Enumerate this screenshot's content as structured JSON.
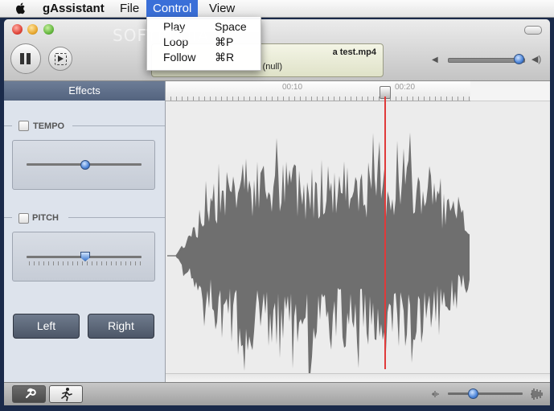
{
  "menubar": {
    "apple_icon": "apple-icon",
    "app_name": "gAssistant",
    "items": [
      "File",
      "Control",
      "View"
    ],
    "active_item": "Control"
  },
  "control_menu": {
    "items": [
      {
        "label": "Play",
        "shortcut": "Space"
      },
      {
        "label": "Loop",
        "shortcut": "⌘P"
      },
      {
        "label": "Follow",
        "shortcut": "⌘R"
      }
    ]
  },
  "watermark": "SOFTPEDIA",
  "toolbar": {
    "pause_icon": "pause-icon",
    "step_icon": "step-play-icon",
    "file_name": "a test.mp4",
    "file_info": "(null)",
    "volume_level": 0.95
  },
  "ruler": {
    "labels": [
      "00:10",
      "00:20"
    ]
  },
  "effects": {
    "header": "Effects",
    "tempo": {
      "label": "TEMPO",
      "checked": false,
      "value": 0.5
    },
    "pitch": {
      "label": "PITCH",
      "checked": false,
      "value": 0.5
    },
    "buttons": {
      "left": "Left",
      "right": "Right"
    }
  },
  "bottom": {
    "tab_icons": [
      "wrench-icon",
      "running-man-icon"
    ],
    "zoom_level": 0.33
  },
  "colors": {
    "menu_highlight": "#3a6fd8",
    "playhead": "#e03a3a",
    "waveform": "#6f6f6f",
    "effects_header": "#5d6d88"
  }
}
